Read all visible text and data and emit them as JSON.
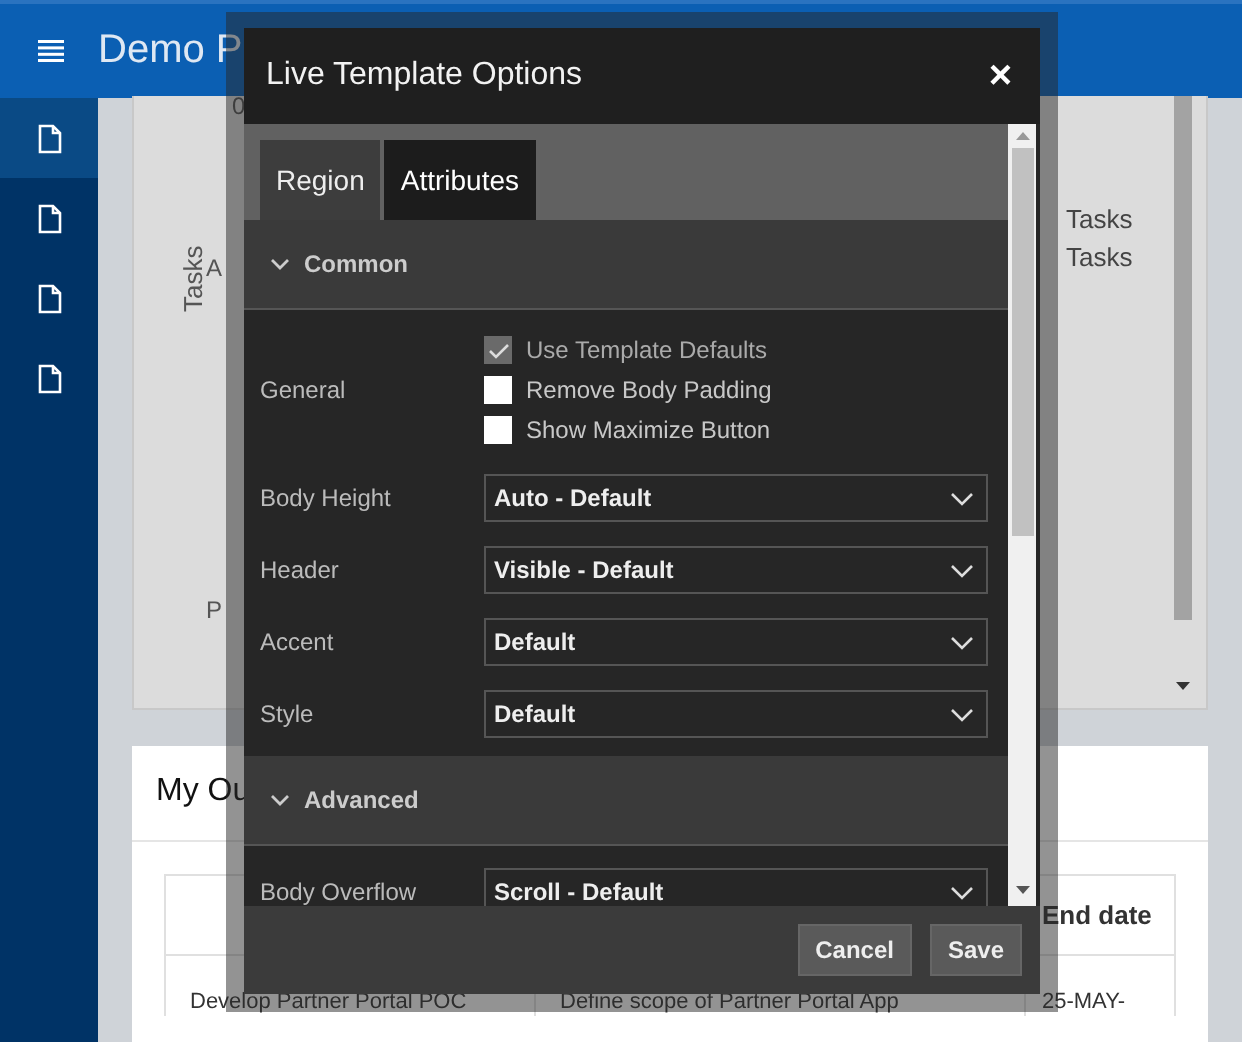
{
  "app_header": {
    "title": "Demo P"
  },
  "sidebar": {
    "items": [
      {
        "selected": true
      },
      {
        "selected": false
      },
      {
        "selected": false
      },
      {
        "selected": false
      }
    ]
  },
  "chart_region": {
    "fragments": [
      {
        "kind": "plain",
        "text": "0"
      },
      {
        "kind": "vertical",
        "text": "Tasks"
      },
      {
        "kind": "plain",
        "text": "A"
      },
      {
        "kind": "plain",
        "text": "P"
      },
      {
        "kind": "legend",
        "text": "Tasks"
      },
      {
        "kind": "legend",
        "text": "Tasks"
      }
    ]
  },
  "report_region": {
    "title": "My Ou",
    "columns": [
      "",
      "",
      "End date"
    ],
    "rows": [
      [
        "Develop Partner Portal POC",
        "Define scope of Partner Portal App",
        "25-MAY-"
      ]
    ]
  },
  "dialog": {
    "title": "Live Template Options",
    "close": "×",
    "tabs": [
      {
        "label": "Region",
        "selected": false
      },
      {
        "label": "Attributes",
        "selected": true
      }
    ],
    "sections": [
      {
        "title": "Common",
        "expanded": true,
        "checkbox_group": {
          "label": "General",
          "options": [
            {
              "label": "Use Template Defaults",
              "checked": true,
              "disabled": true
            },
            {
              "label": "Remove Body Padding",
              "checked": false,
              "disabled": false
            },
            {
              "label": "Show Maximize Button",
              "checked": false,
              "disabled": false
            }
          ]
        },
        "selects": [
          {
            "label": "Body Height",
            "value": "Auto - Default"
          },
          {
            "label": "Header",
            "value": "Visible - Default"
          },
          {
            "label": "Accent",
            "value": "Default"
          },
          {
            "label": "Style",
            "value": "Default"
          }
        ]
      },
      {
        "title": "Advanced",
        "expanded": true,
        "selects": [
          {
            "label": "Body Overflow",
            "value": "Scroll - Default"
          }
        ]
      }
    ],
    "buttons": [
      "Cancel",
      "Save"
    ]
  }
}
